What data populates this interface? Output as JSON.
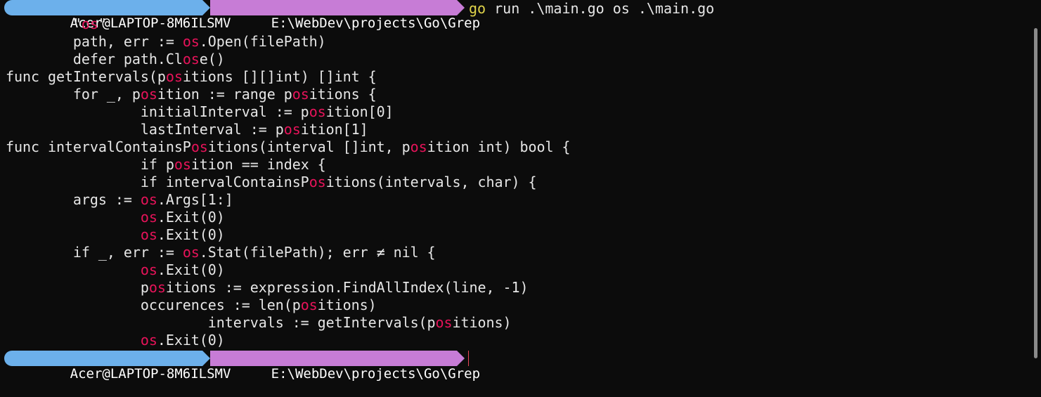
{
  "prompt_top": {
    "user": "Acer@LAPTOP-8M6ILSMV",
    "path": "E:\\WebDev\\projects\\Go\\Grep",
    "command_name": "go",
    "command_args": " run .\\main.go os .\\main.go"
  },
  "output_lines": [
    {
      "parts": [
        {
          "t": "        \""
        },
        {
          "t": "os",
          "m": true
        },
        {
          "t": "\""
        }
      ]
    },
    {
      "parts": [
        {
          "t": "        path, err := "
        },
        {
          "t": "os",
          "m": true
        },
        {
          "t": ".Open(filePath)"
        }
      ]
    },
    {
      "parts": [
        {
          "t": "        defer path.Cl"
        },
        {
          "t": "os",
          "m": true
        },
        {
          "t": "e()"
        }
      ]
    },
    {
      "parts": [
        {
          "t": "func getIntervals(p"
        },
        {
          "t": "os",
          "m": true
        },
        {
          "t": "itions [][]int) []int {"
        }
      ]
    },
    {
      "parts": [
        {
          "t": "        for _, p"
        },
        {
          "t": "os",
          "m": true
        },
        {
          "t": "ition := range p"
        },
        {
          "t": "os",
          "m": true
        },
        {
          "t": "itions {"
        }
      ]
    },
    {
      "parts": [
        {
          "t": "                initialInterval := p"
        },
        {
          "t": "os",
          "m": true
        },
        {
          "t": "ition[0]"
        }
      ]
    },
    {
      "parts": [
        {
          "t": "                lastInterval := p"
        },
        {
          "t": "os",
          "m": true
        },
        {
          "t": "ition[1]"
        }
      ]
    },
    {
      "parts": [
        {
          "t": "func intervalContainsP"
        },
        {
          "t": "os",
          "m": true
        },
        {
          "t": "itions(interval []int, p"
        },
        {
          "t": "os",
          "m": true
        },
        {
          "t": "ition int) bool {"
        }
      ]
    },
    {
      "parts": [
        {
          "t": "                if p"
        },
        {
          "t": "os",
          "m": true
        },
        {
          "t": "ition == index {"
        }
      ]
    },
    {
      "parts": [
        {
          "t": "                if intervalContainsP"
        },
        {
          "t": "os",
          "m": true
        },
        {
          "t": "itions(intervals, char) {"
        }
      ]
    },
    {
      "parts": [
        {
          "t": "        args := "
        },
        {
          "t": "os",
          "m": true
        },
        {
          "t": ".Args[1:]"
        }
      ]
    },
    {
      "parts": [
        {
          "t": "                "
        },
        {
          "t": "os",
          "m": true
        },
        {
          "t": ".Exit(0)"
        }
      ]
    },
    {
      "parts": [
        {
          "t": "                "
        },
        {
          "t": "os",
          "m": true
        },
        {
          "t": ".Exit(0)"
        }
      ]
    },
    {
      "parts": [
        {
          "t": "        if _, err := "
        },
        {
          "t": "os",
          "m": true
        },
        {
          "t": ".Stat(filePath); err ≠ nil {"
        }
      ]
    },
    {
      "parts": [
        {
          "t": "                "
        },
        {
          "t": "os",
          "m": true
        },
        {
          "t": ".Exit(0)"
        }
      ]
    },
    {
      "parts": [
        {
          "t": "                p"
        },
        {
          "t": "os",
          "m": true
        },
        {
          "t": "itions := expression.FindAllIndex(line, -1)"
        }
      ]
    },
    {
      "parts": [
        {
          "t": "                occurences := len(p"
        },
        {
          "t": "os",
          "m": true
        },
        {
          "t": "itions)"
        }
      ]
    },
    {
      "parts": [
        {
          "t": "                        intervals := getIntervals(p"
        },
        {
          "t": "os",
          "m": true
        },
        {
          "t": "itions)"
        }
      ]
    },
    {
      "parts": [
        {
          "t": "                "
        },
        {
          "t": "os",
          "m": true
        },
        {
          "t": ".Exit(0)"
        }
      ]
    }
  ],
  "prompt_bottom": {
    "user": "Acer@LAPTOP-8M6ILSMV",
    "path": "E:\\WebDev\\projects\\Go\\Grep"
  },
  "colors": {
    "background": "#0c0c0c",
    "text": "#e6e6e6",
    "match": "#e8135a",
    "user_segment": "#6cb0eb",
    "path_segment": "#c77cd6",
    "command": "#e0d44a",
    "cursor": "#e74856"
  },
  "icons": {
    "segment_separator": "powerline-arrow-icon"
  }
}
